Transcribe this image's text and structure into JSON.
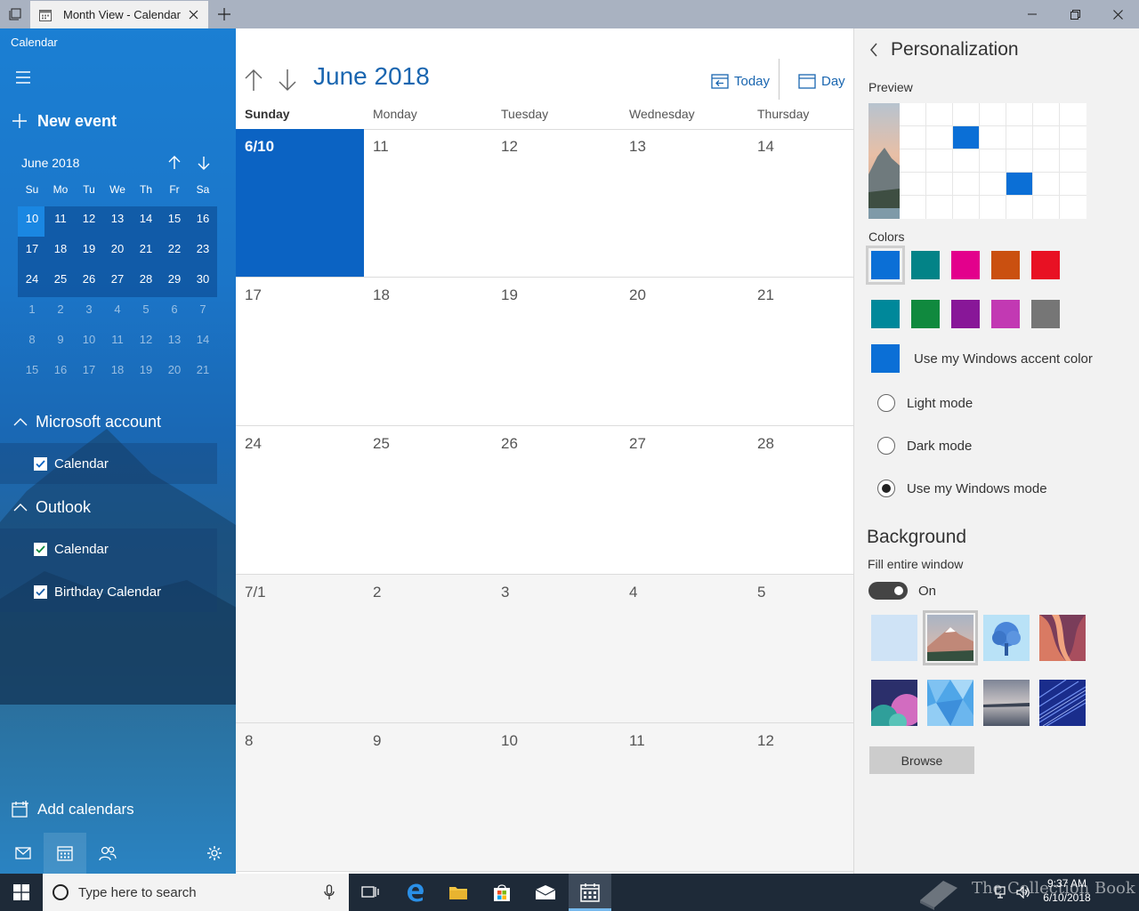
{
  "window": {
    "tab_title": "Month View - Calendar"
  },
  "sidebar": {
    "app_name": "Calendar",
    "new_event": "New event",
    "mini_calendar": {
      "month_label": "June 2018",
      "weekday_headers": [
        "Su",
        "Mo",
        "Tu",
        "We",
        "Th",
        "Fr",
        "Sa"
      ],
      "weeks": [
        [
          "10",
          "11",
          "12",
          "13",
          "14",
          "15",
          "16"
        ],
        [
          "17",
          "18",
          "19",
          "20",
          "21",
          "22",
          "23"
        ],
        [
          "24",
          "25",
          "26",
          "27",
          "28",
          "29",
          "30"
        ],
        [
          "1",
          "2",
          "3",
          "4",
          "5",
          "6",
          "7"
        ],
        [
          "8",
          "9",
          "10",
          "11",
          "12",
          "13",
          "14"
        ],
        [
          "15",
          "16",
          "17",
          "18",
          "19",
          "20",
          "21"
        ]
      ]
    },
    "groups": [
      {
        "name": "Microsoft account",
        "calendars": [
          "Calendar"
        ]
      },
      {
        "name": "Outlook",
        "calendars": [
          "Calendar",
          "Birthday Calendar"
        ]
      }
    ],
    "add_calendars": "Add calendars"
  },
  "main": {
    "month_title": "June 2018",
    "today_label": "Today",
    "day_label": "Day",
    "weekdays": [
      "Sunday",
      "Monday",
      "Tuesday",
      "Wednesday",
      "Thursday"
    ],
    "weeks": [
      [
        "6/10",
        "11",
        "12",
        "13",
        "14"
      ],
      [
        "17",
        "18",
        "19",
        "20",
        "21"
      ],
      [
        "24",
        "25",
        "26",
        "27",
        "28"
      ],
      [
        "7/1",
        "2",
        "3",
        "4",
        "5"
      ],
      [
        "8",
        "9",
        "10",
        "11",
        "12"
      ]
    ]
  },
  "personalization": {
    "title": "Personalization",
    "preview_label": "Preview",
    "colors_label": "Colors",
    "colors_row1": [
      "#0b6fd6",
      "#038387",
      "#e3008c",
      "#ca5010",
      "#e81123"
    ],
    "colors_row2": [
      "#00889a",
      "#10893e",
      "#881798",
      "#c239b3",
      "#767676"
    ],
    "accent_label": "Use my Windows accent color",
    "modes": [
      {
        "label": "Light mode",
        "selected": false
      },
      {
        "label": "Dark mode",
        "selected": false
      },
      {
        "label": "Use my Windows mode",
        "selected": true
      }
    ],
    "background_header": "Background",
    "fill_label": "Fill entire window",
    "toggle_label": "On",
    "browse_label": "Browse"
  },
  "taskbar": {
    "search_placeholder": "Type here to search",
    "time": "9:37 AM",
    "date": "6/10/2018",
    "watermark": "The Collection Book"
  }
}
